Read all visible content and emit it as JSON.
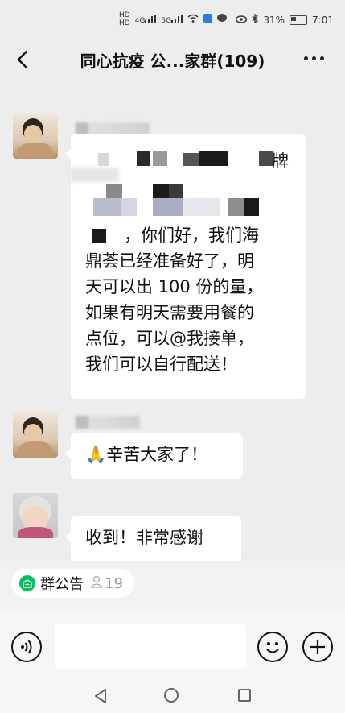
{
  "status_bar": {
    "hd1": "HD",
    "hd2": "HD",
    "signal1": "4G",
    "signal2": "5G",
    "battery": "31%",
    "time": "7:01"
  },
  "header": {
    "title": "同心抗疫 公...家群(109)"
  },
  "messages": [
    {
      "lines": [
        "牌",
        "，你们好，我们海",
        "鼎荟已经准备好了，明",
        "天可以出 100 份的量，",
        "如果有明天需要用餐的",
        "点位，可以@我接单，",
        "我们可以自行配送！"
      ]
    },
    {
      "text": "辛苦大家了！",
      "emoji": "🙏"
    },
    {
      "text": "收到！非常感谢"
    }
  ],
  "announcement": {
    "label": "群公告",
    "count": "19"
  },
  "icons": {
    "back": "back-arrow-icon",
    "more": "more-options-icon",
    "voice": "voice-icon",
    "emoji": "emoji-icon",
    "plus": "plus-icon",
    "notice": "notice-icon",
    "member": "member-icon"
  },
  "colors": {
    "background": "#ededed",
    "accent_green": "#07c160",
    "bubble": "#ffffff"
  }
}
